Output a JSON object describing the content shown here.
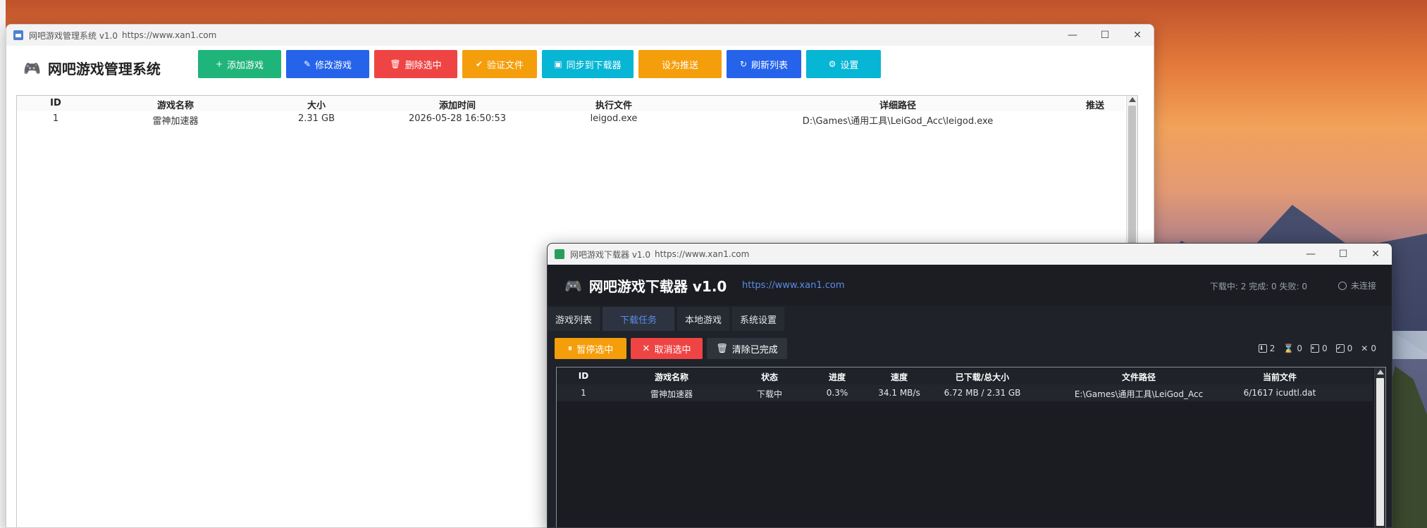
{
  "manager": {
    "window_title": "网吧游戏管理系统 v1.0",
    "window_url": "https://www.xan1.com",
    "brand": "网吧游戏管理系统",
    "toolbar": [
      {
        "id": "add",
        "icon": "+",
        "label": "添加游戏",
        "color": "#1fb47a"
      },
      {
        "id": "edit",
        "icon": "✎",
        "label": "修改游戏",
        "color": "#2563eb"
      },
      {
        "id": "delete",
        "icon": "🗑",
        "label": "删除选中",
        "color": "#ef4444"
      },
      {
        "id": "verify",
        "icon": "✔",
        "label": "验证文件",
        "color": "#f59e0b"
      },
      {
        "id": "sync",
        "icon": "▣",
        "label": "同步到下载器",
        "color": "#06b6d4"
      },
      {
        "id": "push",
        "icon": "",
        "label": "设为推送",
        "color": "#f59e0b"
      },
      {
        "id": "refresh",
        "icon": "↻",
        "label": "刷新列表",
        "color": "#2563eb"
      },
      {
        "id": "settings",
        "icon": "⚙",
        "label": "设置",
        "color": "#06b6d4"
      }
    ],
    "table": {
      "headers": [
        "ID",
        "游戏名称",
        "大小",
        "添加时间",
        "执行文件",
        "详细路径",
        "推送"
      ],
      "rows": [
        [
          "1",
          "雷神加速器",
          "2.31 GB",
          "2026-05-28 16:50:53",
          "leigod.exe",
          "D:\\Games\\通用工具\\LeiGod_Acc\\leigod.exe",
          ""
        ]
      ]
    }
  },
  "downloader": {
    "window_title": "网吧游戏下载器 v1.0",
    "window_url": "https://www.xan1.com",
    "brand": "网吧游戏下载器 v1.0",
    "link": "https://www.xan1.com",
    "stats": "下载中: 2  完成: 0  失败: 0",
    "connection": "未连接",
    "tabs": [
      {
        "label": "游戏列表",
        "active": false
      },
      {
        "label": "下载任务",
        "active": true
      },
      {
        "label": "本地游戏",
        "active": false
      },
      {
        "label": "系统设置",
        "active": false
      }
    ],
    "buttons": [
      {
        "id": "pause",
        "icon": "⏸",
        "label": "暂停选中",
        "color": "#f59e0b"
      },
      {
        "id": "cancel",
        "icon": "✕",
        "label": "取消选中",
        "color": "#ef4444"
      },
      {
        "id": "clear",
        "icon": "🗑",
        "label": "清除已完成",
        "color": "#2f333b"
      }
    ],
    "counters": {
      "downloading": "2",
      "waiting": "0",
      "paused": "0",
      "done": "0",
      "failed": "0"
    },
    "table": {
      "headers": [
        "ID",
        "游戏名称",
        "状态",
        "进度",
        "速度",
        "已下载/总大小",
        "文件路径",
        "当前文件"
      ],
      "rows": [
        [
          "1",
          "雷神加速器",
          "下载中",
          "0.3%",
          "34.1 MB/s",
          "6.72 MB / 2.31 GB",
          "E:\\Games\\通用工具\\LeiGod_Acc",
          "6/1617 icudtl.dat"
        ]
      ]
    }
  }
}
